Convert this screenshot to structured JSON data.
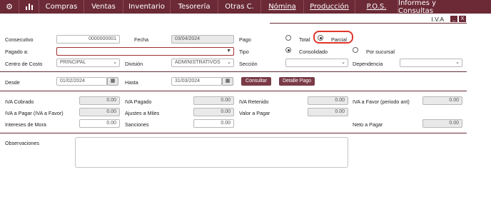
{
  "menu": {
    "items": [
      "Compras",
      "Ventas",
      "Inventario",
      "Tesorería",
      "Otras C.",
      "Nómina",
      "Producción",
      "P.O.S.",
      "Informes y Consultas"
    ]
  },
  "window": {
    "title": "I.V.A",
    "minimize": "_",
    "close": "X"
  },
  "form": {
    "consecutivo_label": "Consecutivo",
    "consecutivo_value": "0000000001",
    "fecha_label": "Fecha",
    "fecha_value": "03/04/2024",
    "pago_label": "Pago",
    "pago_total": "Total",
    "pago_parcial": "Parcial",
    "pagado_a_label": "Pagado a:",
    "tipo_label": "Tipo",
    "tipo_consolidado": "Consolidado",
    "tipo_sucursal": "Por sucursal",
    "centro_costo_label": "Centro de Costo",
    "centro_costo_value": "PRINCIPAL",
    "division_label": "División",
    "division_value": "ADMINISTRATIVOS",
    "seccion_label": "Sección",
    "dependencia_label": "Dependencia",
    "desde_label": "Desde",
    "desde_value": "01/02/2024",
    "hasta_label": "Hasta",
    "hasta_value": "31/03/2024",
    "consultar": "Consultar",
    "detalle_pago": "Detalle Pago"
  },
  "totals": {
    "iva_cobrado_label": "IVA Cobrado",
    "iva_cobrado": "0.00",
    "iva_pagado_label": "IVA Pagado",
    "iva_pagado": "0.00",
    "iva_retenido_label": "IVA Retenido",
    "iva_retenido": "0.00",
    "iva_favor_label": "IVA a Favor (periodo ant)",
    "iva_favor": "0.00",
    "iva_pagar_label": "IVA a Pagar (IVA a Favor)",
    "iva_pagar": "0.00",
    "ajustes_label": "Ajustes a Miles",
    "ajustes": "0.00",
    "valor_pagar_label": "Valor a Pagar",
    "valor_pagar": "0.00",
    "intereses_label": "Intereses de Mora",
    "intereses": "0.00",
    "sanciones_label": "Sanciones",
    "sanciones": "0.00",
    "neto_label": "Neto a Pagar",
    "neto": "0.00"
  },
  "observaciones_label": "Observaciones",
  "colors": {
    "brand": "#6b2a36",
    "highlight": "#e0352b"
  }
}
